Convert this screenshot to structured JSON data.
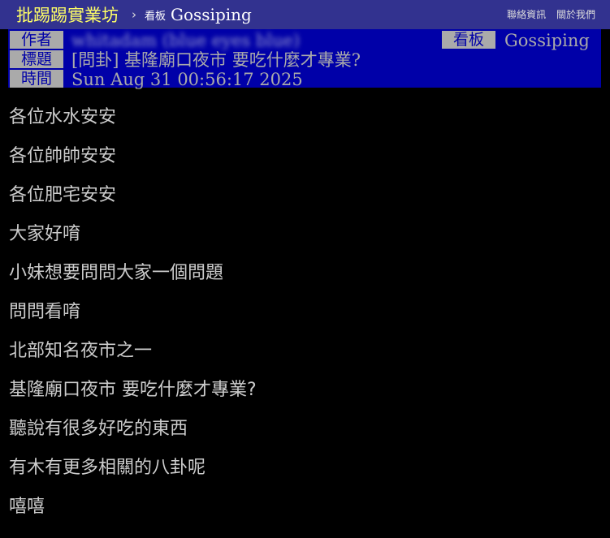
{
  "header": {
    "site_title": "批踢踢實業坊",
    "breadcrumb_separator": "›",
    "board_label": "看板",
    "board_name": "Gossiping",
    "links": [
      "聯絡資訊",
      "關於我們"
    ]
  },
  "meta": {
    "author_tag": "作者",
    "author_value": "whitadam (blue eyes blue)",
    "board_tag": "看板",
    "board_value": "Gossiping",
    "title_tag": "標題",
    "title_value": "[問卦] 基隆廟口夜市 要吃什麼才專業?",
    "time_tag": "時間",
    "time_value": "Sun Aug 31 00:56:17 2025"
  },
  "content": {
    "lines": [
      "各位水水安安",
      "各位帥帥安安",
      "各位肥宅安安",
      "大家好唷",
      "小妹想要問問大家一個問題",
      "問問看唷",
      "北部知名夜市之一",
      "基隆廟口夜市 要吃什麼才專業?",
      "聽說有很多好吃的東西",
      "有木有更多相關的八卦呢",
      "嘻嘻"
    ]
  },
  "colors": {
    "topbar": "#32328f",
    "site_title": "#ffff66",
    "meta_bg": "#0000a8",
    "meta_tag_bg": "#aaaaaa",
    "text": "#cccccc"
  }
}
